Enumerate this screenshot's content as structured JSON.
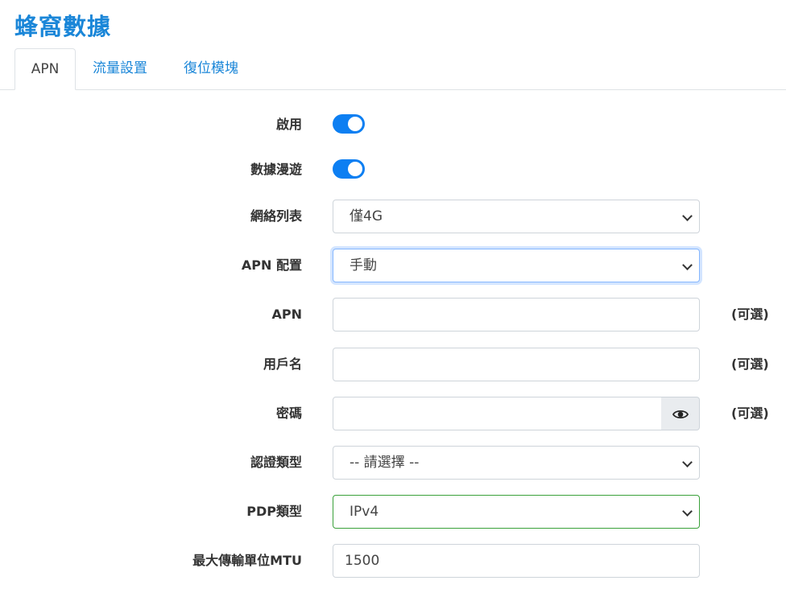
{
  "page": {
    "title": "蜂窩數據"
  },
  "tabs": [
    {
      "label": "APN",
      "active": true
    },
    {
      "label": "流量設置",
      "active": false
    },
    {
      "label": "復位模塊",
      "active": false
    }
  ],
  "form": {
    "enable": {
      "label": "啟用",
      "on": true
    },
    "roaming": {
      "label": "數據漫遊",
      "on": true
    },
    "network_list": {
      "label": "網絡列表",
      "value": "僅4G"
    },
    "apn_config": {
      "label": "APN 配置",
      "value": "手動"
    },
    "apn": {
      "label": "APN",
      "value": "",
      "hint": "(可選)"
    },
    "username": {
      "label": "用戶名",
      "value": "",
      "hint": "(可選)"
    },
    "password": {
      "label": "密碼",
      "value": "",
      "hint": "(可選)"
    },
    "auth_type": {
      "label": "認證類型",
      "value": "-- 請選擇 --"
    },
    "pdp_type": {
      "label": "PDP類型",
      "value": "IPv4"
    },
    "mtu": {
      "label": "最大傳輸單位MTU",
      "value": "1500"
    }
  },
  "icons": {
    "password_toggle": "eye-icon",
    "select_arrow": "chevron-down-icon"
  },
  "colors": {
    "accent": "#1a86d8",
    "toggle_on": "#0d7ff2",
    "valid_border": "#3aa13a"
  }
}
